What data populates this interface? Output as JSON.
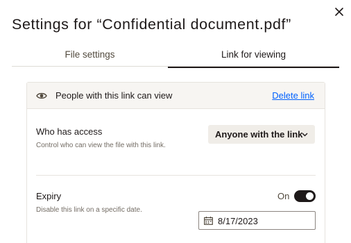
{
  "dialog": {
    "title": "Settings for “Confidential document.pdf”"
  },
  "tabs": [
    {
      "label": "File settings",
      "active": false
    },
    {
      "label": "Link for viewing",
      "active": true
    }
  ],
  "panel": {
    "header_text": "People with this link can view",
    "delete_link": "Delete link",
    "access": {
      "label": "Who has access",
      "description": "Control who can view the file with this link.",
      "selected": "Anyone with the link"
    },
    "expiry": {
      "label": "Expiry",
      "description": "Disable this link on a specific date.",
      "toggle_label": "On",
      "enabled": true,
      "date": "8/17/2023"
    }
  },
  "colors": {
    "link": "#0061fe",
    "toggle_on": "#1e1919",
    "header_bg": "#f7f5f2"
  },
  "icons": {
    "close": "close-icon",
    "eye": "eye-icon",
    "chevron": "chevron-down-icon",
    "calendar": "calendar-icon"
  }
}
